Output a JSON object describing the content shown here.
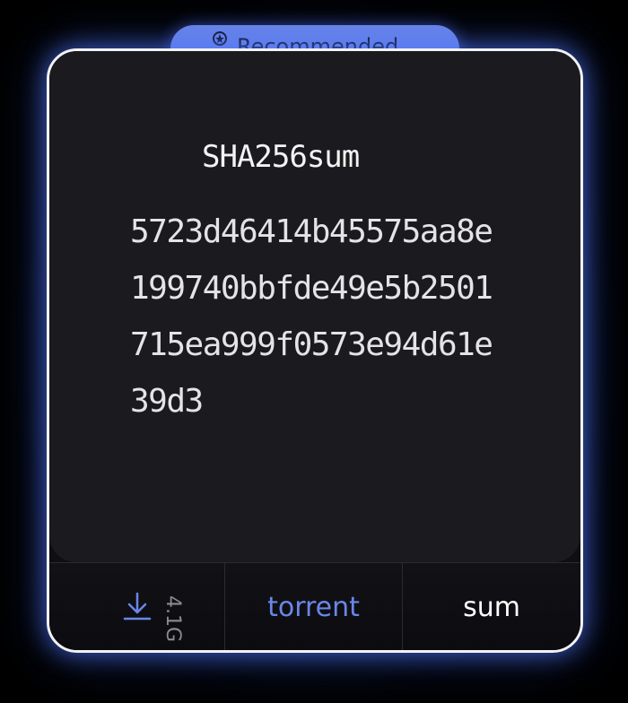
{
  "ribbon": {
    "label": "Recommended",
    "icon": "badge-icon"
  },
  "card": {
    "title": "SHA256sum",
    "hash": "5723d46414b45575aa8e199740bbfde49e5b2501715ea999f0573e94d61e39d3"
  },
  "footer": {
    "size": "4.1G",
    "download_icon": "download-icon",
    "torrent_label": "torrent",
    "sum_label": "sum"
  },
  "colors": {
    "accent": "#6b86e8",
    "panel": "#1b1b1f",
    "border": "#f2f2f5"
  }
}
